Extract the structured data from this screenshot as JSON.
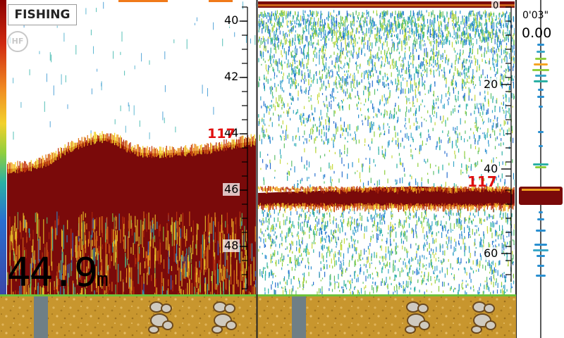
{
  "header": {
    "mode_label": "FISHING",
    "frequency_badge": "HF"
  },
  "zoom_panel": {
    "depth_scale_labels": [
      "40",
      "42",
      "44",
      "46",
      "48"
    ],
    "bottom_depth_marker": "117",
    "current_depth_value": "44.9",
    "current_depth_unit": "m"
  },
  "history_panel": {
    "depth_scale_labels": [
      "0",
      "20",
      "40",
      "60"
    ],
    "bottom_depth_marker": "117"
  },
  "a_scope": {
    "elapsed_time": "0'03\"",
    "speed": "0.00"
  },
  "color_bar": [
    "#8b0000",
    "#b22222",
    "#e23a10",
    "#f07020",
    "#f5a623",
    "#f2d12b",
    "#c6d93a",
    "#6cc24a",
    "#2bb0a5",
    "#2a7fd0",
    "#3a56b8",
    "#ffffff"
  ],
  "colors": {
    "bottom_echo": "#7a0a0a",
    "seabed_ground": "#c89a3a",
    "ground_line": "#6fc23a",
    "panel_divider": "#222222",
    "header_bar": "#f07a1a"
  },
  "icons": {
    "freq": "hf-circle-icon"
  }
}
